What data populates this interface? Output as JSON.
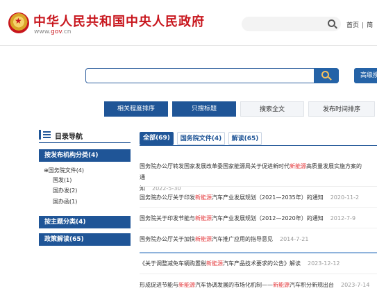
{
  "header": {
    "site_title": "中华人民共和国中央人民政府",
    "url_prefix": "www.",
    "url_gov": "gov",
    "url_suffix": ".cn",
    "links": [
      "首页",
      "简"
    ]
  },
  "search": {
    "advanced_label": "高级搜"
  },
  "sort_buttons": [
    "相关程度排序",
    "只搜标题",
    "搜索全文",
    "发布时间排序"
  ],
  "nav": {
    "title": "目录导航",
    "groups": [
      "按发布机构分类(4)",
      "按主题分类(4)",
      "政策解读(65)"
    ],
    "sub_items": [
      "⊕国务院文件(4)",
      "国发(1)",
      "国办发(2)",
      "国办函(1)"
    ]
  },
  "tabs": [
    "全部(69)",
    "国务院文件(4)",
    "解读(65)"
  ],
  "results": [
    {
      "before": "国务院办公厅转发国家发展改革委国家能源局关于促进新时代",
      "hl": "新能源",
      "after": "高质量发展实施方案的通",
      "line2": "知",
      "date": "2022-5-30"
    },
    {
      "before": "国务院办公厅关于印发",
      "hl": "新能源",
      "after": "汽车产业发展规划（2021—2035年）的通知",
      "date": "2020-11-2"
    },
    {
      "before": "国务院关于印发节能与",
      "hl": "新能源",
      "after": "汽车产业发展规划（2012—2020年）的通知",
      "date": "2012-7-9"
    },
    {
      "before": "国务院办公厅关于加快",
      "hl": "新能源",
      "after": "汽车推广应用的指导意见",
      "date": "2014-7-21"
    },
    {
      "before": "《关于调整减免车辆购置税",
      "hl": "新能源",
      "after": "汽车产品技术要求的公告》解读",
      "date": "2023-12-12"
    },
    {
      "before": "形成促进节能与",
      "hl": "新能源",
      "after": "汽车协调发展的市场化机制——",
      "hl2": "新能源",
      "after2": "汽车积分新规出台",
      "date": "2023-7-14"
    }
  ],
  "colors": {
    "brand_red": "#c8161d",
    "primary_blue": "#1f5597",
    "highlight": "#e4393c"
  }
}
